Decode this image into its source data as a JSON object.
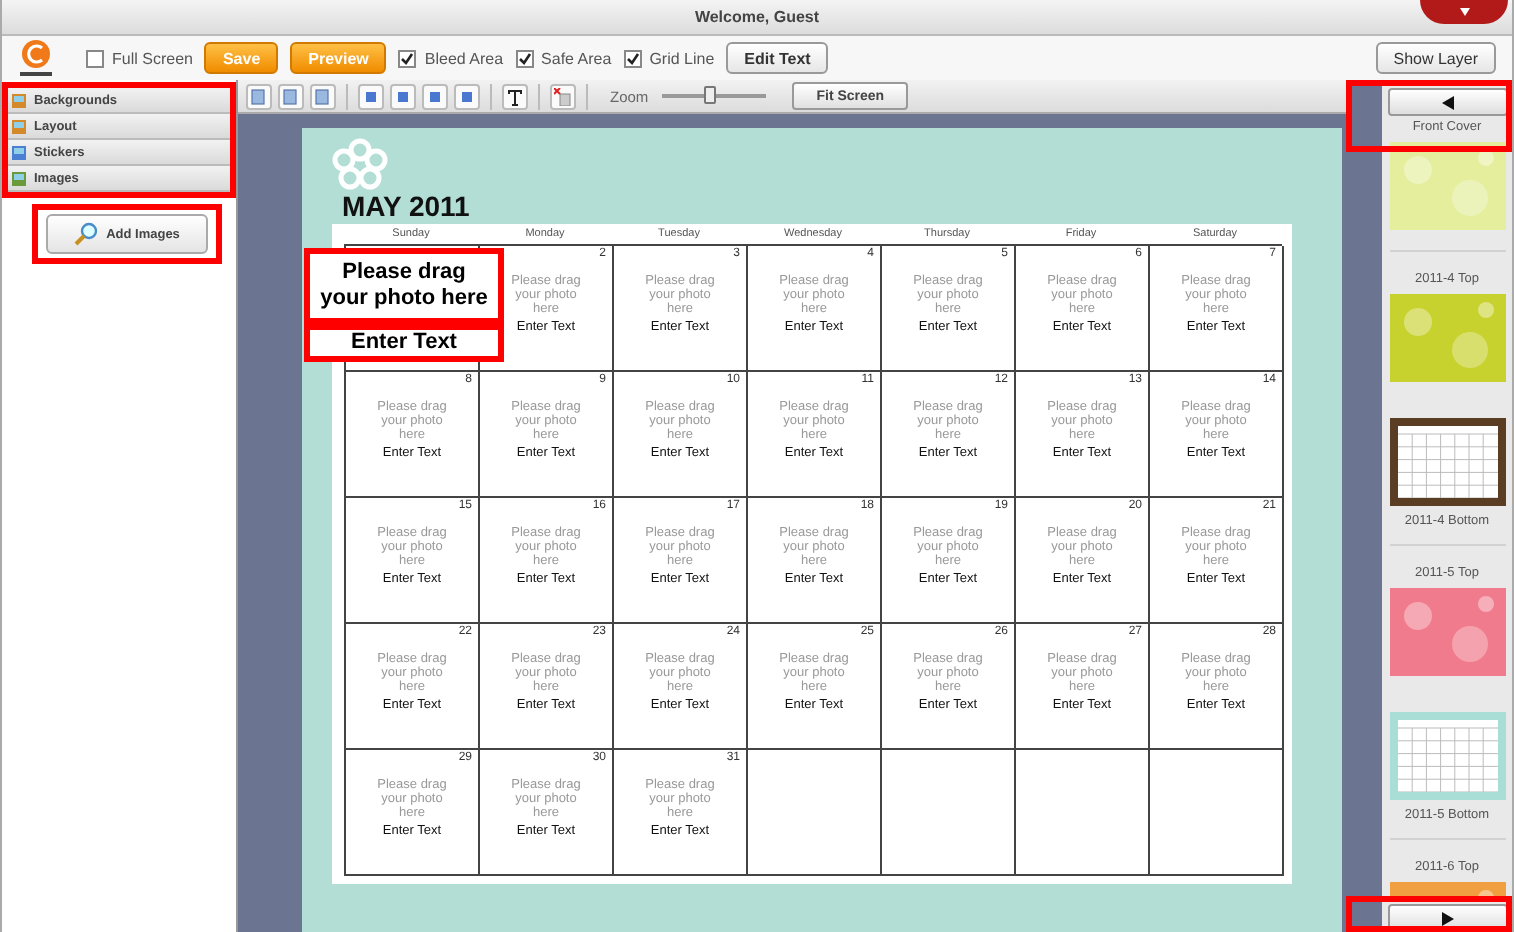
{
  "window": {
    "title": "Welcome, Guest"
  },
  "toolbar": {
    "items": [
      {
        "kind": "checkbox",
        "label": "Full Screen",
        "checked": false
      },
      {
        "kind": "action",
        "label": "Save"
      },
      {
        "kind": "action",
        "label": "Preview"
      },
      {
        "kind": "checkbox",
        "label": "Bleed Area",
        "checked": true
      },
      {
        "kind": "checkbox",
        "label": "Safe Area",
        "checked": true
      },
      {
        "kind": "checkbox",
        "label": "Grid Line",
        "checked": true
      },
      {
        "kind": "button",
        "label": "Edit Text"
      }
    ],
    "right_button": "Show Layer"
  },
  "sidebar": {
    "highlighted": true,
    "items": [
      {
        "label": "Backgrounds"
      },
      {
        "label": "Layout"
      },
      {
        "label": "Stickers"
      },
      {
        "label": "Images"
      }
    ],
    "add_button": {
      "label": "Add Images",
      "highlighted": true
    }
  },
  "edit_toolbar": {
    "zoom_label": "Zoom",
    "zoom": {
      "level": 0.45
    },
    "fit_button": "Fit Screen"
  },
  "page": {
    "title": "MAY 2011",
    "weekdays": [
      "Sunday",
      "Monday",
      "Tuesday",
      "Wednesday",
      "Thursday",
      "Friday",
      "Saturday"
    ],
    "weeks": [
      [
        {
          "kind": "large",
          "photo_hint": "Please drag your photo here",
          "text": "Enter Text",
          "highlighted": true
        },
        {
          "kind": "day",
          "day": "2",
          "photo_hint": "Please drag your photo here",
          "text": "Enter Text"
        },
        {
          "kind": "day",
          "day": "3",
          "photo_hint": "Please drag your photo here",
          "text": "Enter Text"
        },
        {
          "kind": "day",
          "day": "4",
          "photo_hint": "Please drag your photo here",
          "text": "Enter Text"
        },
        {
          "kind": "day",
          "day": "5",
          "photo_hint": "Please drag your photo here",
          "text": "Enter Text"
        },
        {
          "kind": "day",
          "day": "6",
          "photo_hint": "Please drag your photo here",
          "text": "Enter Text"
        },
        {
          "kind": "day",
          "day": "7",
          "photo_hint": "Please drag your photo here",
          "text": "Enter Text"
        }
      ],
      [
        {
          "kind": "day",
          "day": "8",
          "photo_hint": "Please drag your photo here",
          "text": "Enter Text"
        },
        {
          "kind": "day",
          "day": "9",
          "photo_hint": "Please drag your photo here",
          "text": "Enter Text"
        },
        {
          "kind": "day",
          "day": "10",
          "photo_hint": "Please drag your photo here",
          "text": "Enter Text"
        },
        {
          "kind": "day",
          "day": "11",
          "photo_hint": "Please drag your photo here",
          "text": "Enter Text"
        },
        {
          "kind": "day",
          "day": "12",
          "photo_hint": "Please drag your photo here",
          "text": "Enter Text"
        },
        {
          "kind": "day",
          "day": "13",
          "photo_hint": "Please drag your photo here",
          "text": "Enter Text"
        },
        {
          "kind": "day",
          "day": "14",
          "photo_hint": "Please drag your photo here",
          "text": "Enter Text"
        }
      ],
      [
        {
          "kind": "day",
          "day": "15",
          "photo_hint": "Please drag your photo here",
          "text": "Enter Text"
        },
        {
          "kind": "day",
          "day": "16",
          "photo_hint": "Please drag your photo here",
          "text": "Enter Text"
        },
        {
          "kind": "day",
          "day": "17",
          "photo_hint": "Please drag your photo here",
          "text": "Enter Text"
        },
        {
          "kind": "day",
          "day": "18",
          "photo_hint": "Please drag your photo here",
          "text": "Enter Text"
        },
        {
          "kind": "day",
          "day": "19",
          "photo_hint": "Please drag your photo here",
          "text": "Enter Text"
        },
        {
          "kind": "day",
          "day": "20",
          "photo_hint": "Please drag your photo here",
          "text": "Enter Text"
        },
        {
          "kind": "day",
          "day": "21",
          "photo_hint": "Please drag your photo here",
          "text": "Enter Text"
        }
      ],
      [
        {
          "kind": "day",
          "day": "22",
          "photo_hint": "Please drag your photo here",
          "text": "Enter Text"
        },
        {
          "kind": "day",
          "day": "23",
          "photo_hint": "Please drag your photo here",
          "text": "Enter Text"
        },
        {
          "kind": "day",
          "day": "24",
          "photo_hint": "Please drag your photo here",
          "text": "Enter Text"
        },
        {
          "kind": "day",
          "day": "25",
          "photo_hint": "Please drag your photo here",
          "text": "Enter Text"
        },
        {
          "kind": "day",
          "day": "26",
          "photo_hint": "Please drag your photo here",
          "text": "Enter Text"
        },
        {
          "kind": "day",
          "day": "27",
          "photo_hint": "Please drag your photo here",
          "text": "Enter Text"
        },
        {
          "kind": "day",
          "day": "28",
          "photo_hint": "Please drag your photo here",
          "text": "Enter Text"
        }
      ],
      [
        {
          "kind": "day",
          "day": "29",
          "photo_hint": "Please drag your photo here",
          "text": "Enter Text"
        },
        {
          "kind": "day",
          "day": "30",
          "photo_hint": "Please drag your photo here",
          "text": "Enter Text"
        },
        {
          "kind": "day",
          "day": "31",
          "photo_hint": "Please drag your photo here",
          "text": "Enter Text"
        },
        {
          "kind": "empty"
        },
        {
          "kind": "empty"
        },
        {
          "kind": "empty"
        },
        {
          "kind": "empty"
        }
      ]
    ]
  },
  "pages_panel": {
    "nav_highlighted": true,
    "pages": [
      {
        "kind": "top",
        "label": "Front Cover",
        "color": "#e4ee9c"
      },
      {
        "kind": "top",
        "label": "2011-4 Top",
        "color": "#c8d22e"
      },
      {
        "kind": "bottom",
        "label": "2011-4 Bottom",
        "color": "#5a3d22"
      },
      {
        "kind": "top",
        "label": "2011-5 Top",
        "color": "#f07b8c"
      },
      {
        "kind": "bottom",
        "label": "2011-5 Bottom",
        "color": "#a9ded6"
      },
      {
        "kind": "top",
        "label": "2011-6 Top",
        "color": "#f0a040"
      }
    ]
  }
}
